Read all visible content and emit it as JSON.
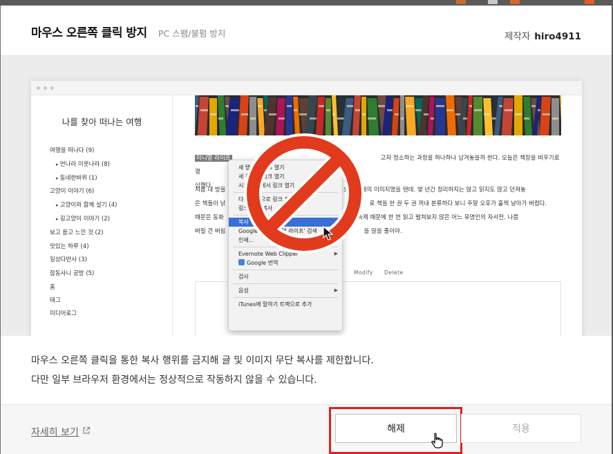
{
  "plugin": {
    "title": "마우스 오른쪽 클릭 방지",
    "subtitle": "PC 스팸/불펌 방지",
    "author_label": "제작자",
    "author_name": "hiro4911"
  },
  "preview": {
    "blog_title": "나를 찾아 떠나는 여행",
    "categories": [
      {
        "label": "여행을 떠나다 (9)",
        "sub": false
      },
      {
        "label": "먼나라 이웃나라 (8)",
        "sub": true
      },
      {
        "label": "동네한바퀴 (1)",
        "sub": true
      },
      {
        "label": "고양이 이야기 (6)",
        "sub": false
      },
      {
        "label": "고양이와 함께 살기 (4)",
        "sub": true
      },
      {
        "label": "길고양이 이야기 (2)",
        "sub": true
      },
      {
        "label": "보고 듣고 느낀 것 (2)",
        "sub": false
      },
      {
        "label": "맛있는 하루 (4)",
        "sub": false
      },
      {
        "label": "일상다반사 (3)",
        "sub": false
      },
      {
        "label": "잡동사니 공방 (5)",
        "sub": false
      }
    ],
    "nav_links": [
      "홈",
      "태그",
      "미디어로그"
    ],
    "paragraph1": {
      "selected": "미니멀 라이프",
      "rest_line1": "고자 청소하는 과정을 하나하나 남겨놓을까 한다. 오늘은 책장을 비우기로 결",
      "line2": "심했다."
    },
    "paragraph2": {
      "line1_start": "처음 내 방을",
      "line1_end": "인 오",
      "line1_far": "서재의 이미지였을 텐데. 몇 년간 정리하지는 않고 읽지도 않고 던져놓",
      "line2_start": "은 책들이 낡",
      "line2_far": "로 책을 한 권 두 권 꺼내 분류하다 보니 주말 오후가 훌쩍 날아가 버렸다.",
      "line3_start": "때문은 동화",
      "line3_far": "추감 숙제 때문에 한 번 읽고 펼쳐보지 않은 어느 유명인의 자서전. 나름",
      "line4_start": "버릴 건 버림",
      "line4_far": "을 많을 줄이야."
    },
    "post_actions": {
      "modify": "Modify",
      "delete": "Delete"
    },
    "context_menu": [
      {
        "label": "새 탭에서 링크 열기",
        "type": "item"
      },
      {
        "label": "새 창에서 링크 열기",
        "type": "item"
      },
      {
        "label": "시크릿 창에서 링크 열기",
        "type": "item"
      },
      {
        "type": "separator"
      },
      {
        "label": "다른 이름으로 링크 저장...",
        "type": "item"
      },
      {
        "label": "링크 주소 복사",
        "type": "item"
      },
      {
        "type": "separator"
      },
      {
        "label": "복사",
        "type": "item",
        "highlight": true
      },
      {
        "label": "Google에서 '미니멀 라이프' 검색",
        "type": "item"
      },
      {
        "label": "인쇄...",
        "type": "item"
      },
      {
        "type": "separator"
      },
      {
        "label": "Evernote Web Clipper",
        "type": "item",
        "arrow": true
      },
      {
        "label": "Google 번역",
        "type": "item",
        "icon": true
      },
      {
        "type": "separator"
      },
      {
        "label": "검사",
        "type": "item"
      },
      {
        "type": "separator"
      },
      {
        "label": "음성",
        "type": "item",
        "arrow": true
      },
      {
        "type": "separator"
      },
      {
        "label": "iTunes에 말하기 트랙으로 추가",
        "type": "item"
      }
    ]
  },
  "description": {
    "line1": "마우스 오른쪽 클릭을 통한 복사 행위를 금지해 글 및 이미지 무단 복사를 제한합니다.",
    "line2": "다만 일부 브라우저 환경에서는 정상적으로 작동하지 않을 수 있습니다."
  },
  "footer": {
    "details_link": "자세히 보기",
    "release_button": "해제",
    "apply_button": "적용"
  },
  "colors": {
    "highlight_frame": "#e02020",
    "no_sign": "#e23a1c",
    "menu_highlight": "#3b6fd6"
  }
}
